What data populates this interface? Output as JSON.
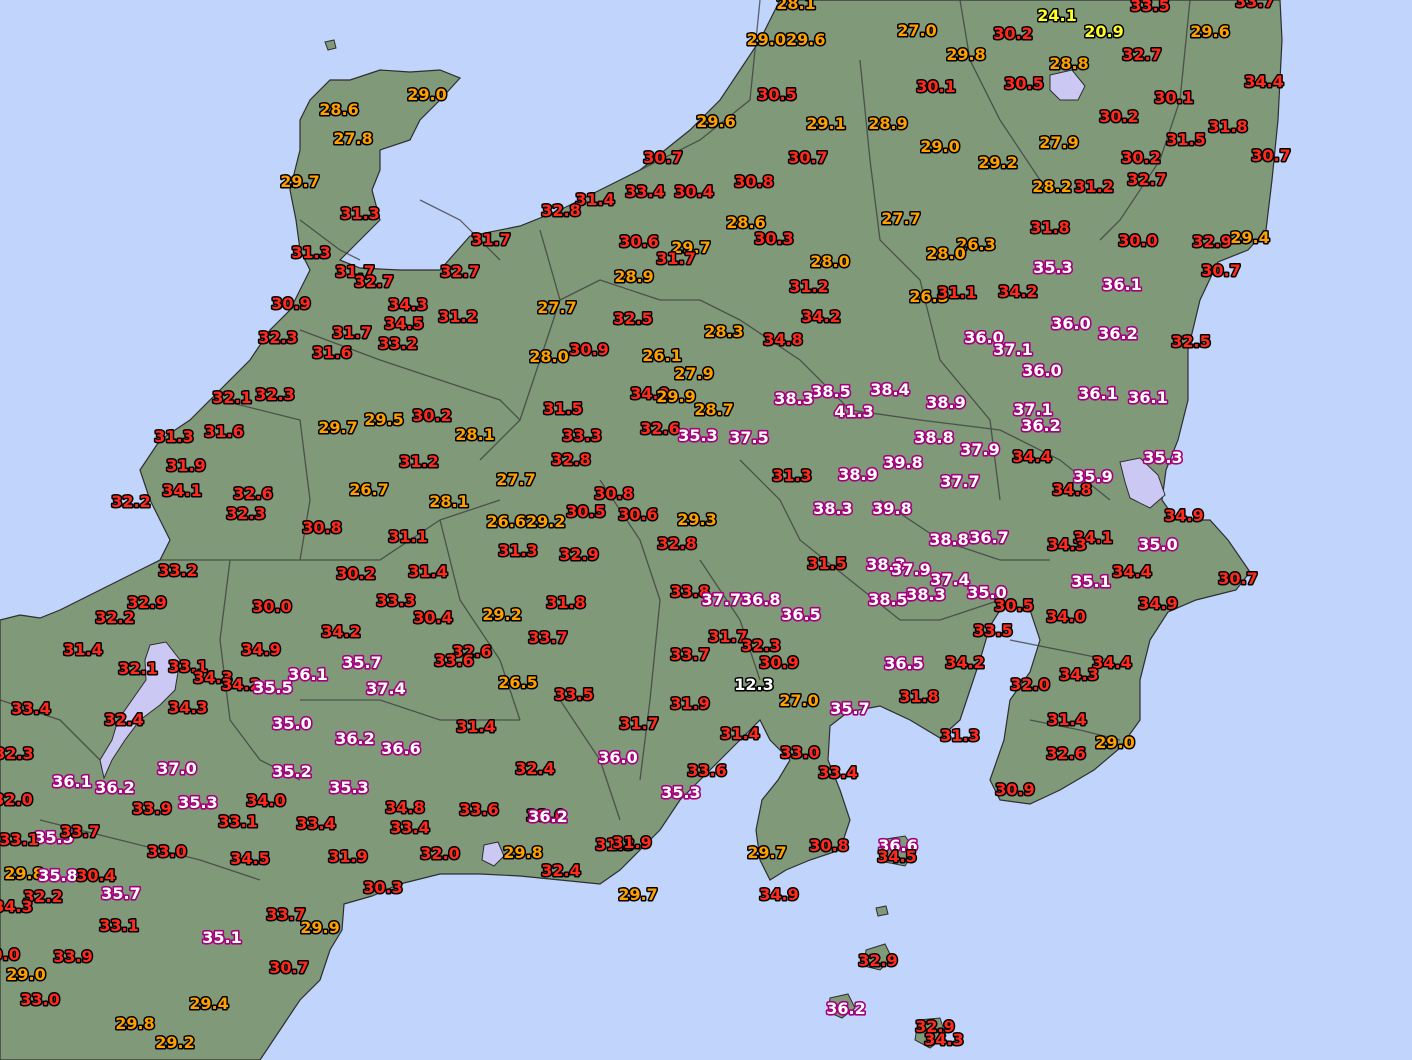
{
  "colors": {
    "sea": "#c0d4fc",
    "land": "#7f9979",
    "lake": "#ccc8f4",
    "boundary": "#3c3c3c",
    "temp_red": "#ff2a1a",
    "temp_orange": "#ff9f00",
    "temp_magenta_outline": "#a4007c",
    "temp_yellow": "#ffff2a",
    "temp_white": "#ffffff"
  },
  "legend_note": "Temperature labels colored by band: yellow < 25, orange 25-30, red 30-35, white/magenta >= 35",
  "labels": [
    {
      "t": "28.1",
      "c": "orange"
    },
    {
      "t": "33.5",
      "c": "red"
    },
    {
      "t": "33.7",
      "c": "red"
    },
    {
      "t": "29.029.6",
      "c": "orange"
    },
    {
      "t": "27.0",
      "c": "orange"
    },
    {
      "t": "30.2",
      "c": "red"
    },
    {
      "t": "24.1",
      "c": "yellow"
    },
    {
      "t": "20.9",
      "c": "yellow"
    },
    {
      "t": "29.6",
      "c": "orange"
    },
    {
      "t": "29.8",
      "c": "orange"
    },
    {
      "t": "28.8",
      "c": "orange"
    },
    {
      "t": "32.7",
      "c": "red"
    },
    {
      "t": "34.4",
      "c": "red"
    },
    {
      "t": "29.0",
      "c": "orange"
    },
    {
      "t": "30.5",
      "c": "red"
    },
    {
      "t": "30.1",
      "c": "red"
    },
    {
      "t": "30.5",
      "c": "red"
    },
    {
      "t": "30.1",
      "c": "red"
    },
    {
      "t": "28.6",
      "c": "orange"
    },
    {
      "t": "30.2",
      "c": "red"
    },
    {
      "t": "29.6",
      "c": "orange"
    },
    {
      "t": "29.1",
      "c": "orange"
    },
    {
      "t": "28.9",
      "c": "orange"
    },
    {
      "t": "31.8",
      "c": "red"
    },
    {
      "t": "27.8",
      "c": "orange"
    },
    {
      "t": "31.5",
      "c": "red"
    },
    {
      "t": "29.0",
      "c": "orange"
    },
    {
      "t": "27.9",
      "c": "orange"
    },
    {
      "t": "30.7",
      "c": "red"
    },
    {
      "t": "30.7",
      "c": "red"
    },
    {
      "t": "29.2",
      "c": "orange"
    },
    {
      "t": "30.2",
      "c": "red"
    },
    {
      "t": "30.7",
      "c": "red"
    },
    {
      "t": "29.7",
      "c": "orange"
    },
    {
      "t": "30.8",
      "c": "red"
    },
    {
      "t": "32.7",
      "c": "red"
    },
    {
      "t": "33.4",
      "c": "red"
    },
    {
      "t": "30.4",
      "c": "red"
    },
    {
      "t": "28.2",
      "c": "orange"
    },
    {
      "t": "31.2",
      "c": "red"
    },
    {
      "t": "31.4",
      "c": "red"
    },
    {
      "t": "32.8",
      "c": "red"
    },
    {
      "t": "31.3",
      "c": "red"
    },
    {
      "t": "27.7",
      "c": "orange"
    },
    {
      "t": "28.6",
      "c": "orange"
    },
    {
      "t": "31.8",
      "c": "red"
    },
    {
      "t": "31.7",
      "c": "red"
    },
    {
      "t": "30.6",
      "c": "red"
    },
    {
      "t": "29.7",
      "c": "orange"
    },
    {
      "t": "30.3",
      "c": "red"
    },
    {
      "t": "26.3",
      "c": "orange"
    },
    {
      "t": "30.0",
      "c": "red"
    },
    {
      "t": "32.9",
      "c": "red"
    },
    {
      "t": "29.4",
      "c": "orange"
    },
    {
      "t": "31.3",
      "c": "red"
    },
    {
      "t": "31.7",
      "c": "red"
    },
    {
      "t": "28.0",
      "c": "orange"
    },
    {
      "t": "28.0",
      "c": "orange"
    },
    {
      "t": "31.7",
      "c": "red"
    },
    {
      "t": "32.7",
      "c": "red"
    },
    {
      "t": "32.7",
      "c": "red"
    },
    {
      "t": "28.9",
      "c": "orange"
    },
    {
      "t": "35.3",
      "c": "magenta"
    },
    {
      "t": "30.7",
      "c": "red"
    },
    {
      "t": "31.2",
      "c": "red"
    },
    {
      "t": "36.1",
      "c": "magenta"
    },
    {
      "t": "30.9",
      "c": "red"
    },
    {
      "t": "34.3",
      "c": "red"
    },
    {
      "t": "26.3",
      "c": "orange"
    },
    {
      "t": "31.1",
      "c": "red"
    },
    {
      "t": "34.2",
      "c": "red"
    },
    {
      "t": "34.5",
      "c": "red"
    },
    {
      "t": "31.2",
      "c": "red"
    },
    {
      "t": "27.7",
      "c": "orange"
    },
    {
      "t": "32.5",
      "c": "red"
    },
    {
      "t": "34.2",
      "c": "red"
    },
    {
      "t": "36.0",
      "c": "magenta"
    },
    {
      "t": "32.3",
      "c": "red"
    },
    {
      "t": "31.7",
      "c": "red"
    },
    {
      "t": "28.3",
      "c": "orange"
    },
    {
      "t": "36.2",
      "c": "magenta"
    },
    {
      "t": "33.2",
      "c": "red"
    },
    {
      "t": "34.8",
      "c": "red"
    },
    {
      "t": "36.0",
      "c": "magenta"
    },
    {
      "t": "32.5",
      "c": "red"
    },
    {
      "t": "31.6",
      "c": "red"
    },
    {
      "t": "30.9",
      "c": "red"
    },
    {
      "t": "26.1",
      "c": "orange"
    },
    {
      "t": "37.1",
      "c": "magenta"
    },
    {
      "t": "28.0",
      "c": "orange"
    },
    {
      "t": "36.0",
      "c": "magenta"
    },
    {
      "t": "27.9",
      "c": "orange"
    },
    {
      "t": "32.1",
      "c": "red"
    },
    {
      "t": "32.3",
      "c": "red"
    },
    {
      "t": "34.9",
      "c": "red"
    },
    {
      "t": "38.5",
      "c": "magenta"
    },
    {
      "t": "38.4",
      "c": "magenta"
    },
    {
      "t": "36.1",
      "c": "magenta"
    },
    {
      "t": "36.1",
      "c": "magenta"
    },
    {
      "t": "29.9",
      "c": "orange"
    },
    {
      "t": "38.3",
      "c": "magenta"
    },
    {
      "t": "38.9",
      "c": "magenta"
    },
    {
      "t": "37.1",
      "c": "magenta"
    },
    {
      "t": "29.5",
      "c": "orange"
    },
    {
      "t": "30.2",
      "c": "red"
    },
    {
      "t": "31.5",
      "c": "red"
    },
    {
      "t": "28.7",
      "c": "orange"
    },
    {
      "t": "41.3",
      "c": "magenta"
    },
    {
      "t": "31.3",
      "c": "red"
    },
    {
      "t": "31.6",
      "c": "red"
    },
    {
      "t": "29.7",
      "c": "orange"
    },
    {
      "t": "28.1",
      "c": "orange"
    },
    {
      "t": "33.3",
      "c": "red"
    },
    {
      "t": "32.6",
      "c": "red"
    },
    {
      "t": "35.3",
      "c": "magenta"
    },
    {
      "t": "37.5",
      "c": "magenta"
    },
    {
      "t": "38.8",
      "c": "magenta"
    },
    {
      "t": "36.2",
      "c": "magenta"
    },
    {
      "t": "37.9",
      "c": "magenta"
    },
    {
      "t": "35.3",
      "c": "magenta"
    },
    {
      "t": "31.9",
      "c": "red"
    },
    {
      "t": "31.2",
      "c": "red"
    },
    {
      "t": "32.8",
      "c": "red"
    },
    {
      "t": "39.8",
      "c": "magenta"
    },
    {
      "t": "34.4",
      "c": "red"
    },
    {
      "t": "38.9",
      "c": "magenta"
    },
    {
      "t": "31.3",
      "c": "red"
    },
    {
      "t": "35.9",
      "c": "magenta"
    },
    {
      "t": "27.7",
      "c": "orange"
    },
    {
      "t": "37.7",
      "c": "magenta"
    },
    {
      "t": "34.1",
      "c": "red"
    },
    {
      "t": "26.7",
      "c": "orange"
    },
    {
      "t": "30.8",
      "c": "red"
    },
    {
      "t": "34.8",
      "c": "red"
    },
    {
      "t": "32.2",
      "c": "red"
    },
    {
      "t": "32.6",
      "c": "red"
    },
    {
      "t": "28.1",
      "c": "orange"
    },
    {
      "t": "30.5",
      "c": "red"
    },
    {
      "t": "38.3",
      "c": "magenta"
    },
    {
      "t": "39.8",
      "c": "magenta"
    },
    {
      "t": "34.9",
      "c": "red"
    },
    {
      "t": "32.3",
      "c": "red"
    },
    {
      "t": "30.6",
      "c": "red"
    },
    {
      "t": "29.3",
      "c": "orange"
    },
    {
      "t": "30.8",
      "c": "red"
    },
    {
      "t": "26.629.2",
      "c": "orange"
    },
    {
      "t": "31.1",
      "c": "red"
    },
    {
      "t": "38.8",
      "c": "magenta"
    },
    {
      "t": "36.7",
      "c": "magenta"
    },
    {
      "t": "34.1",
      "c": "red"
    },
    {
      "t": "32.8",
      "c": "red"
    },
    {
      "t": "34.3",
      "c": "red"
    },
    {
      "t": "35.0",
      "c": "magenta"
    },
    {
      "t": "31.3",
      "c": "red"
    },
    {
      "t": "32.9",
      "c": "red"
    },
    {
      "t": "33.2",
      "c": "red"
    },
    {
      "t": "31.5",
      "c": "red"
    },
    {
      "t": "38.3",
      "c": "magenta"
    },
    {
      "t": "37.9",
      "c": "magenta"
    },
    {
      "t": "30.2",
      "c": "red"
    },
    {
      "t": "31.4",
      "c": "red"
    },
    {
      "t": "37.4",
      "c": "magenta"
    },
    {
      "t": "34.4",
      "c": "red"
    },
    {
      "t": "30.7",
      "c": "red"
    },
    {
      "t": "35.1",
      "c": "magenta"
    },
    {
      "t": "33.3",
      "c": "red"
    },
    {
      "t": "31.8",
      "c": "red"
    },
    {
      "t": "33.8",
      "c": "red"
    },
    {
      "t": "37.736.8",
      "c": "magenta"
    },
    {
      "t": "38.5",
      "c": "magenta"
    },
    {
      "t": "38.3",
      "c": "magenta"
    },
    {
      "t": "35.0",
      "c": "magenta"
    },
    {
      "t": "34.9",
      "c": "red"
    },
    {
      "t": "32.9",
      "c": "red"
    },
    {
      "t": "30.0",
      "c": "red"
    },
    {
      "t": "30.5",
      "c": "red"
    },
    {
      "t": "32.2",
      "c": "red"
    },
    {
      "t": "30.4",
      "c": "red"
    },
    {
      "t": "29.2",
      "c": "orange"
    },
    {
      "t": "36.5",
      "c": "magenta"
    },
    {
      "t": "34.0",
      "c": "red"
    },
    {
      "t": "34.2",
      "c": "red"
    },
    {
      "t": "33.7",
      "c": "red"
    },
    {
      "t": "31.7",
      "c": "red"
    },
    {
      "t": "32.3",
      "c": "red"
    },
    {
      "t": "33.5",
      "c": "red"
    },
    {
      "t": "31.4",
      "c": "red"
    },
    {
      "t": "34.9",
      "c": "red"
    },
    {
      "t": "32.6",
      "c": "red"
    },
    {
      "t": "32.1",
      "c": "red"
    },
    {
      "t": "33.1",
      "c": "red"
    },
    {
      "t": "35.7",
      "c": "magenta"
    },
    {
      "t": "33.6",
      "c": "red"
    },
    {
      "t": "33.7",
      "c": "red"
    },
    {
      "t": "30.9",
      "c": "red"
    },
    {
      "t": "36.5",
      "c": "magenta"
    },
    {
      "t": "34.2",
      "c": "red"
    },
    {
      "t": "34.4",
      "c": "red"
    },
    {
      "t": "34.3",
      "c": "red"
    },
    {
      "t": "36.1",
      "c": "magenta"
    },
    {
      "t": "34.3",
      "c": "red"
    },
    {
      "t": "34.2",
      "c": "red"
    },
    {
      "t": "35.5",
      "c": "magenta"
    },
    {
      "t": "37.4",
      "c": "magenta"
    },
    {
      "t": "26.5",
      "c": "orange"
    },
    {
      "t": "12.3",
      "c": "white"
    },
    {
      "t": "32.0",
      "c": "red"
    },
    {
      "t": "33.4",
      "c": "red"
    },
    {
      "t": "34.3",
      "c": "red"
    },
    {
      "t": "33.5",
      "c": "red"
    },
    {
      "t": "31.8",
      "c": "red"
    },
    {
      "t": "27.0",
      "c": "orange"
    },
    {
      "t": "31.9",
      "c": "red"
    },
    {
      "t": "35.7",
      "c": "magenta"
    },
    {
      "t": "32.4",
      "c": "red"
    },
    {
      "t": "35.0",
      "c": "magenta"
    },
    {
      "t": "31.4",
      "c": "red"
    },
    {
      "t": "31.7",
      "c": "red"
    },
    {
      "t": "31.4",
      "c": "red"
    },
    {
      "t": "31.3",
      "c": "red"
    },
    {
      "t": "31.4",
      "c": "red"
    },
    {
      "t": "36.2",
      "c": "magenta"
    },
    {
      "t": "36.6",
      "c": "magenta"
    },
    {
      "t": "29.0",
      "c": "orange"
    },
    {
      "t": "32.3",
      "c": "red"
    },
    {
      "t": "36.0",
      "c": "magenta"
    },
    {
      "t": "33.0",
      "c": "red"
    },
    {
      "t": "32.6",
      "c": "red"
    },
    {
      "t": "37.0",
      "c": "magenta"
    },
    {
      "t": "35.2",
      "c": "magenta"
    },
    {
      "t": "32.4",
      "c": "red"
    },
    {
      "t": "33.6",
      "c": "red"
    },
    {
      "t": "33.4",
      "c": "red"
    },
    {
      "t": "36.1",
      "c": "magenta"
    },
    {
      "t": "36.2",
      "c": "magenta"
    },
    {
      "t": "35.3",
      "c": "magenta"
    },
    {
      "t": "35.3",
      "c": "magenta"
    },
    {
      "t": "32.0",
      "c": "red"
    },
    {
      "t": "34.0",
      "c": "red"
    },
    {
      "t": "30.9",
      "c": "red"
    },
    {
      "t": "33.9",
      "c": "red"
    },
    {
      "t": "35.3",
      "c": "magenta"
    },
    {
      "t": "34.8",
      "c": "red"
    },
    {
      "t": "33.6",
      "c": "red"
    },
    {
      "t": "33.0",
      "c": "red"
    },
    {
      "t": "33.1",
      "c": "red"
    },
    {
      "t": "33.4",
      "c": "red"
    },
    {
      "t": "33.4",
      "c": "red"
    },
    {
      "t": "36.2",
      "c": "magenta"
    },
    {
      "t": "35.5",
      "c": "magenta"
    },
    {
      "t": "33.7",
      "c": "red"
    },
    {
      "t": "33.1",
      "c": "red"
    },
    {
      "t": "31.3",
      "c": "red"
    },
    {
      "t": "31.9",
      "c": "red"
    },
    {
      "t": "30.8",
      "c": "red"
    },
    {
      "t": "36.6",
      "c": "magenta"
    },
    {
      "t": "33.0",
      "c": "red"
    },
    {
      "t": "31.9",
      "c": "red"
    },
    {
      "t": "32.0",
      "c": "red"
    },
    {
      "t": "29.8",
      "c": "orange"
    },
    {
      "t": "29.7",
      "c": "orange"
    },
    {
      "t": "34.5",
      "c": "red"
    },
    {
      "t": "34.5",
      "c": "red"
    },
    {
      "t": "29.8",
      "c": "orange"
    },
    {
      "t": "35.8",
      "c": "magenta"
    },
    {
      "t": "30.4",
      "c": "red"
    },
    {
      "t": "32.4",
      "c": "red"
    },
    {
      "t": "35.7",
      "c": "magenta"
    },
    {
      "t": "32.2",
      "c": "red"
    },
    {
      "t": "30.3",
      "c": "red"
    },
    {
      "t": "29.7",
      "c": "orange"
    },
    {
      "t": "34.9",
      "c": "red"
    },
    {
      "t": "34.3",
      "c": "red"
    },
    {
      "t": "33.7",
      "c": "red"
    },
    {
      "t": "29.9",
      "c": "orange"
    },
    {
      "t": "33.1",
      "c": "red"
    },
    {
      "t": "35.1",
      "c": "magenta"
    },
    {
      "t": "33.9",
      "c": "red"
    },
    {
      "t": "30.0",
      "c": "red"
    },
    {
      "t": "30.7",
      "c": "red"
    },
    {
      "t": "32.9",
      "c": "red"
    },
    {
      "t": "29.0",
      "c": "orange"
    },
    {
      "t": "33.0",
      "c": "red"
    },
    {
      "t": "29.4",
      "c": "orange"
    },
    {
      "t": "36.2",
      "c": "magenta"
    },
    {
      "t": "29.8",
      "c": "orange"
    },
    {
      "t": "32.9",
      "c": "red"
    },
    {
      "t": "29.2",
      "c": "orange"
    },
    {
      "t": "34.3",
      "c": "red"
    }
  ]
}
